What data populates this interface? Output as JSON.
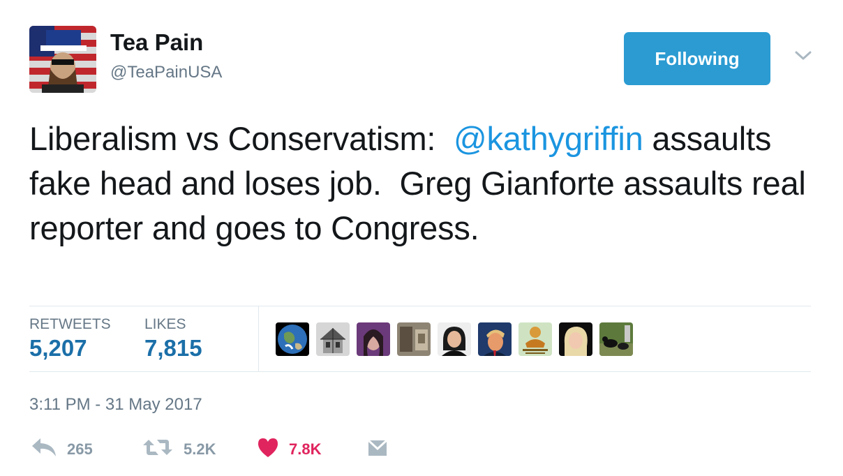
{
  "author": {
    "display_name": "Tea Pain",
    "handle": "@TeaPainUSA"
  },
  "follow_button": {
    "label": "Following"
  },
  "tweet": {
    "text_before": "Liberalism vs Conservatism:  ",
    "mention": "@kathygriffin",
    "text_after": " assaults fake head and loses job.  Greg Gianforte assaults real reporter and goes to Congress."
  },
  "stats": {
    "retweets_label": "RETWEETS",
    "retweets_value": "5,207",
    "likes_label": "LIKES",
    "likes_value": "7,815"
  },
  "likers": [
    {
      "icon": "earth-avatar"
    },
    {
      "icon": "house-sketch-avatar"
    },
    {
      "icon": "woman-portrait-avatar"
    },
    {
      "icon": "shop-photo-avatar"
    },
    {
      "icon": "woman-dark-hair-avatar"
    },
    {
      "icon": "man-suit-avatar"
    },
    {
      "icon": "meme-poster-avatar"
    },
    {
      "icon": "blonde-woman-avatar"
    },
    {
      "icon": "dogs-outdoor-avatar"
    }
  ],
  "timestamp": "3:11 PM - 31 May 2017",
  "actions": {
    "reply_count": "265",
    "retweet_count": "5.2K",
    "like_count": "7.8K"
  },
  "colors": {
    "accent": "#1b95e0",
    "follow_button": "#2b9bd2",
    "like_active": "#e0245e",
    "muted": "#8899a6"
  }
}
